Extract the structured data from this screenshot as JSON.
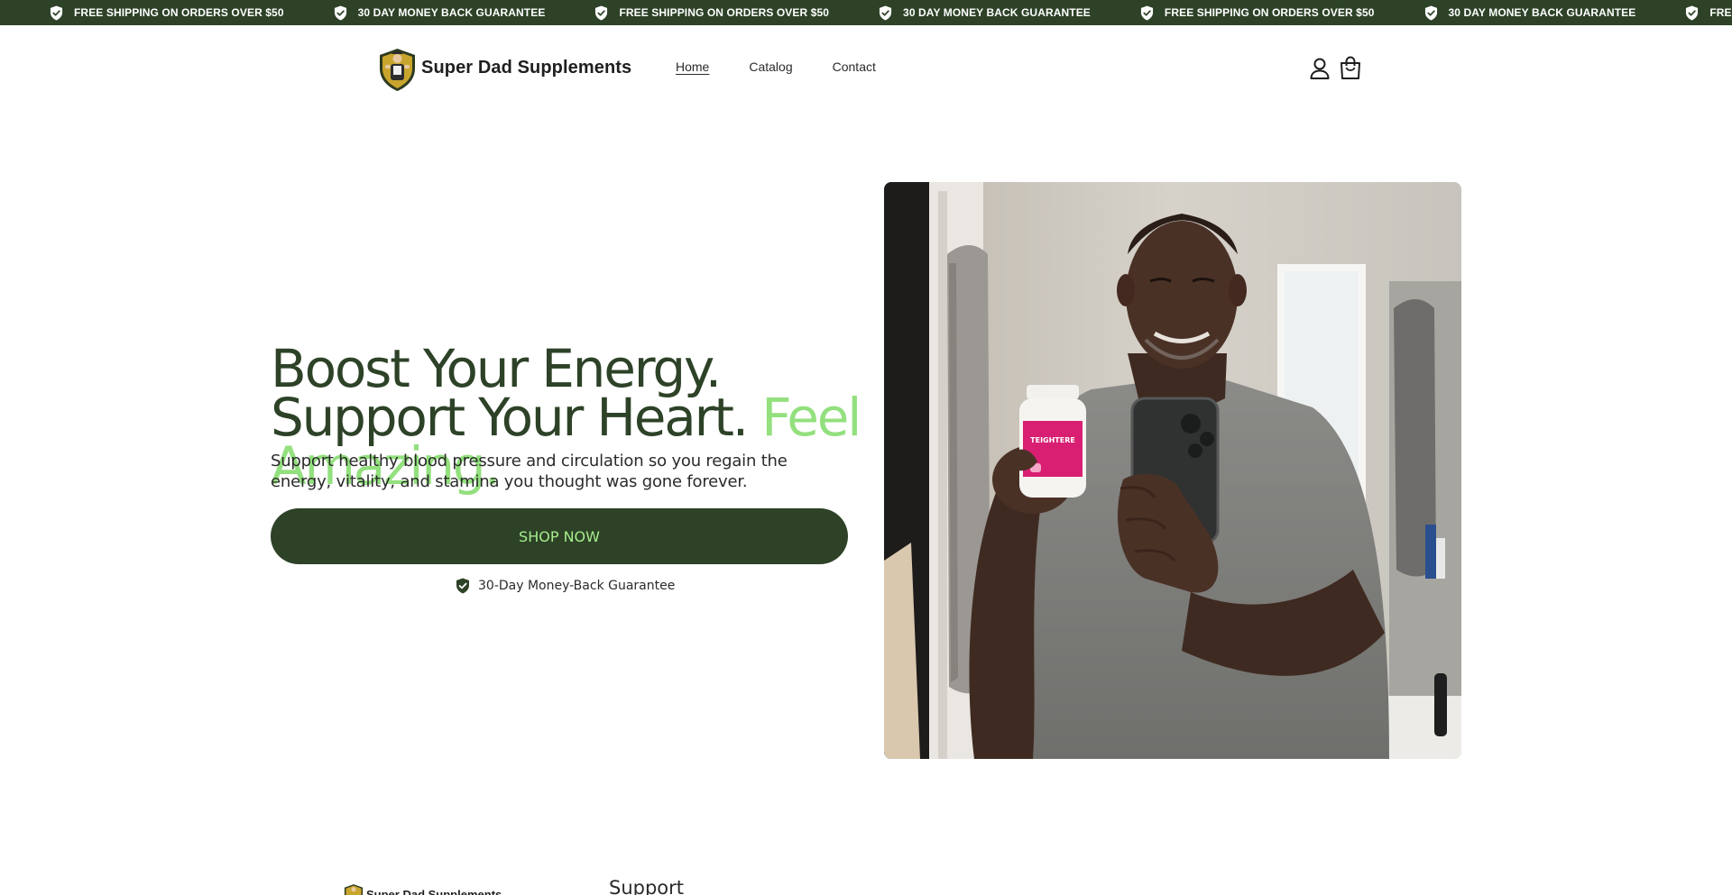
{
  "announcement": {
    "items": [
      {
        "text": "FREE SHIPPING ON ORDERS OVER $50",
        "icon": "shield-check-icon"
      },
      {
        "text": "30 DAY MONEY BACK GUARANTEE",
        "icon": "shield-check-icon"
      },
      {
        "text": "FREE SHIPPING ON ORDERS OVER $50",
        "icon": "shield-check-icon"
      },
      {
        "text": "30 DAY MONEY BACK GUARANTEE",
        "icon": "shield-check-icon"
      },
      {
        "text": "FREE SHIPPING ON ORDERS OVER $50",
        "icon": "shield-check-icon"
      },
      {
        "text": "30 DAY MONEY BACK GUARANTEE",
        "icon": "shield-check-icon"
      },
      {
        "text": "FREE SHIPPING",
        "icon": "shield-check-icon"
      }
    ]
  },
  "header": {
    "brand": "Super Dad Supplements",
    "nav": [
      {
        "label": "Home",
        "active": true
      },
      {
        "label": "Catalog",
        "active": false
      },
      {
        "label": "Contact",
        "active": false
      }
    ],
    "icons": [
      "account-icon",
      "cart-icon"
    ]
  },
  "hero": {
    "title_main": "Boost Your Energy. Support Your Heart. ",
    "title_accent": "Feel Amazing.",
    "subtitle": "Support healthy blood pressure and circulation so you regain the energy, vitality, and stamina you thought was gone forever.",
    "cta": "SHOP NOW",
    "guarantee": "30-Day Money-Back Guarantee",
    "bottle_label": "TEIGHTERE"
  },
  "footer": {
    "brand": "Super Dad Supplements",
    "heading": "Support"
  },
  "colors": {
    "brand_green": "#2d4227",
    "accent_green": "#93e07e",
    "button_text": "#a6ec8c"
  }
}
